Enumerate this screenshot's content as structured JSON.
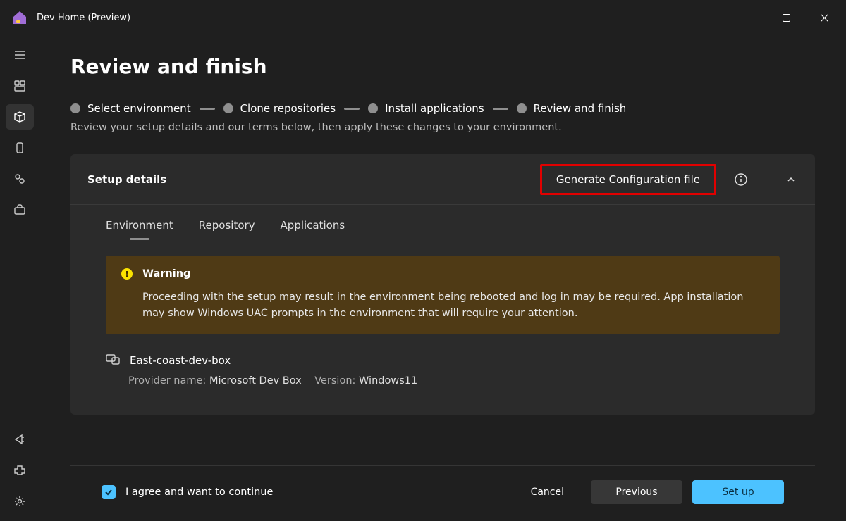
{
  "app": {
    "title": "Dev Home (Preview)"
  },
  "page": {
    "title": "Review and finish",
    "subtitle": "Review your setup details and our terms below, then apply these changes to your environment."
  },
  "stepper": {
    "steps": [
      {
        "label": "Select environment"
      },
      {
        "label": "Clone repositories"
      },
      {
        "label": "Install applications"
      },
      {
        "label": "Review and finish"
      }
    ]
  },
  "panel": {
    "title": "Setup details",
    "generate_label": "Generate Configuration file"
  },
  "tabs": {
    "items": [
      {
        "label": "Environment",
        "active": true
      },
      {
        "label": "Repository",
        "active": false
      },
      {
        "label": "Applications",
        "active": false
      }
    ]
  },
  "warning": {
    "title": "Warning",
    "text": "Proceeding with the setup may result in the environment being rebooted and log in may be required. App installation may show Windows UAC prompts in the environment that will require your attention."
  },
  "environment": {
    "name": "East-coast-dev-box",
    "provider_label": "Provider name:",
    "provider_value": "Microsoft Dev Box",
    "version_label": "Version:",
    "version_value": "Windows11"
  },
  "footer": {
    "agree_label": "I agree and want to continue",
    "cancel": "Cancel",
    "previous": "Previous",
    "setup": "Set up"
  }
}
